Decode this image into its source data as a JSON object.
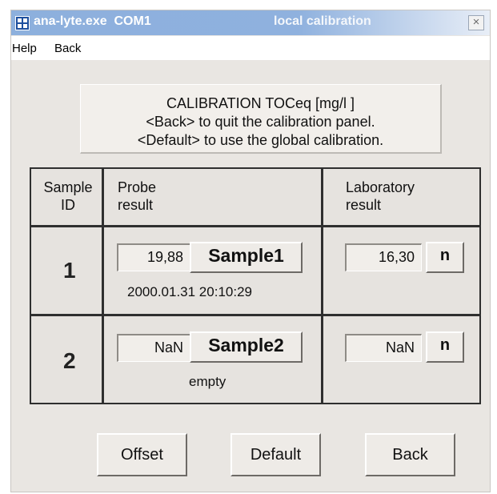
{
  "window": {
    "app_title": "ana-lyte.exe  COM1",
    "mode_title": "local calibration",
    "close_label": "×"
  },
  "menu": {
    "help": "Help",
    "back": "Back"
  },
  "info": {
    "line1": "CALIBRATION TOCeq    [mg/l    ]",
    "line2": "<Back> to quit the calibration panel.",
    "line3": "<Default> to use the global calibration."
  },
  "table": {
    "headers": {
      "sample_id": [
        "Sample",
        "ID"
      ],
      "probe": [
        "Probe",
        "result"
      ],
      "lab": [
        "Laboratory",
        "result"
      ]
    },
    "rows": [
      {
        "id": "1",
        "probe_value": "19,88",
        "sample_button": "Sample1",
        "timestamp": "2000.01.31  20:10:29",
        "lab_value": "16,30",
        "n_button": "n"
      },
      {
        "id": "2",
        "probe_value": "NaN",
        "sample_button": "Sample2",
        "timestamp": "empty",
        "lab_value": "NaN",
        "n_button": "n"
      }
    ]
  },
  "buttons": {
    "offset": "Offset",
    "default": "Default",
    "back": "Back"
  }
}
